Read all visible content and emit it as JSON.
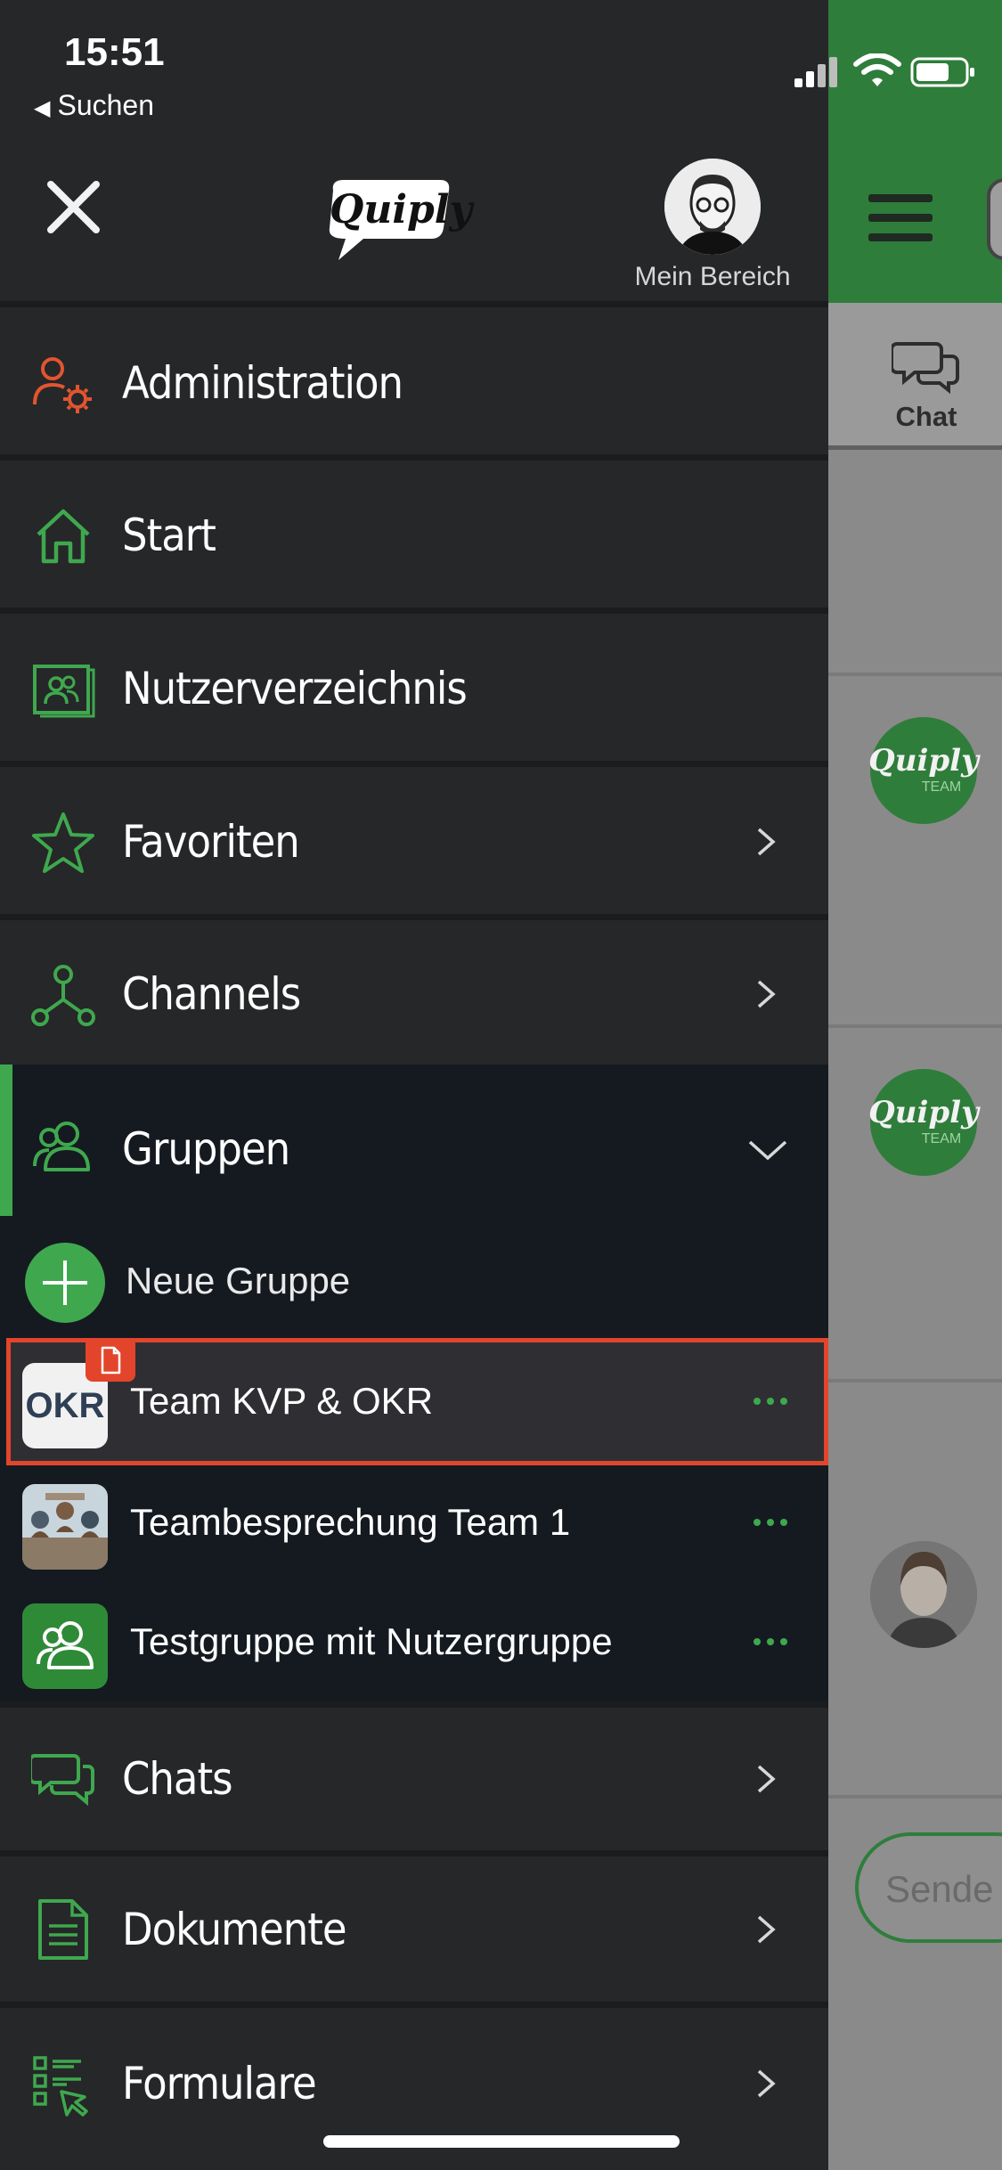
{
  "status_bar": {
    "time": "15:51",
    "back_label": "Suchen"
  },
  "header": {
    "logo_text": "Quiply",
    "profile_label": "Mein Bereich"
  },
  "menu": {
    "administration": "Administration",
    "start": "Start",
    "directory": "Nutzerverzeichnis",
    "favorites": "Favoriten",
    "channels": "Channels",
    "groups": "Gruppen",
    "chats": "Chats",
    "documents": "Dokumente",
    "forms": "Formulare"
  },
  "groups": {
    "new_group": "Neue Gruppe",
    "items": [
      {
        "name": "Team KVP & OKR",
        "thumb_text": "OKR"
      },
      {
        "name": "Teambesprechung Team 1"
      },
      {
        "name": "Testgruppe mit Nutzergruppe"
      }
    ]
  },
  "background": {
    "tab_chat": "Chat",
    "avatar_text": "Quiply",
    "avatar_sub": "TEAM",
    "send_placeholder": "Sende"
  },
  "colors": {
    "accent_green": "#3fa84e",
    "admin_orange": "#e2552f",
    "highlight_red": "#e2452b",
    "drawer_bg": "#262729",
    "groups_bg": "#151a21"
  },
  "icons": {
    "administration": "user-gear-icon",
    "start": "home-icon",
    "directory": "contact-card-icon",
    "favorites": "star-icon",
    "channels": "network-icon",
    "groups": "users-icon",
    "chats": "chat-bubbles-icon",
    "documents": "document-icon",
    "forms": "form-list-icon"
  }
}
